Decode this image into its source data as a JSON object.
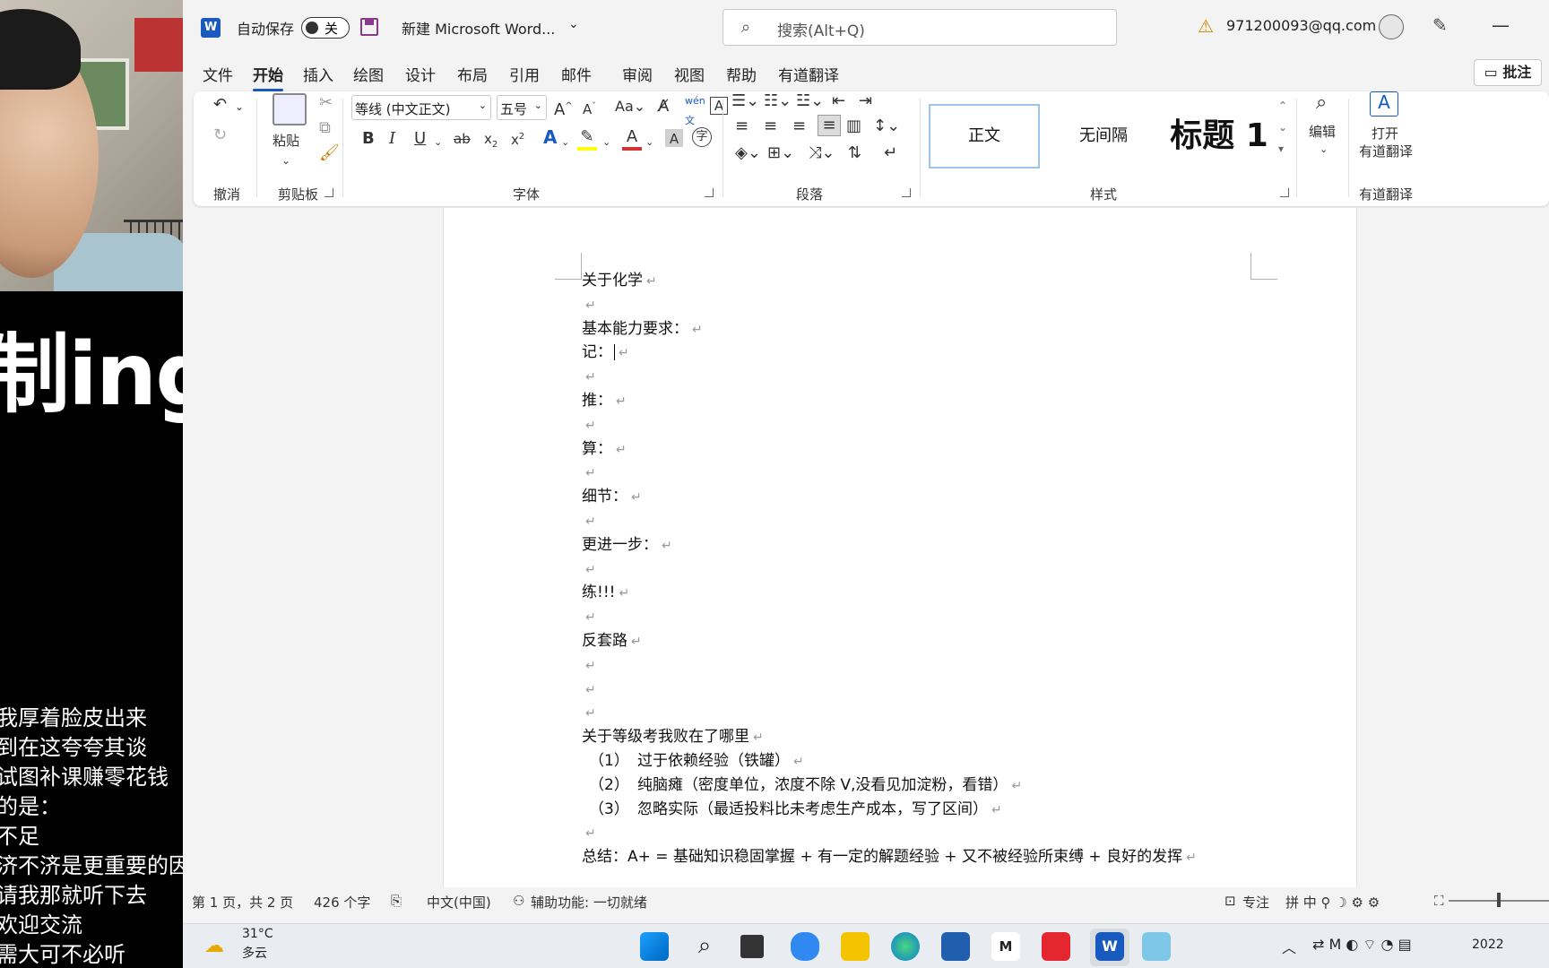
{
  "overlay": {
    "big_text": "制ing",
    "subtitles": [
      "我厚着脸皮出来",
      "到在这夸夸其谈",
      "试图补课赚零花钱",
      "的是：",
      "不足",
      "济不济是更重要的因素",
      "请我那就听下去",
      "欢迎交流",
      "需大可不必听"
    ]
  },
  "titlebar": {
    "autosave_label": "自动保存",
    "autosave_state": "关",
    "doc_title": "新建 Microsoft Word...",
    "search_placeholder": "搜索(Alt+Q)",
    "account": "971200093@qq.com"
  },
  "menu": {
    "items": [
      "文件",
      "开始",
      "插入",
      "绘图",
      "设计",
      "布局",
      "引用",
      "邮件",
      "审阅",
      "视图",
      "帮助",
      "有道翻译"
    ],
    "active": "开始",
    "comment_label": "批注"
  },
  "ribbon": {
    "groups": {
      "undo": "撤消",
      "clipboard": "剪贴板",
      "font": "字体",
      "paragraph": "段落",
      "styles": "样式",
      "editing": "编辑",
      "youdao": "有道翻译"
    },
    "paste_label": "粘贴",
    "font_name": "等线 (中文正文)",
    "font_size": "五号",
    "styles": [
      "正文",
      "无间隔",
      "标题 1"
    ],
    "edit_label": "编辑",
    "youdao_open": "打开",
    "youdao_label": "有道翻译"
  },
  "document": {
    "lines": [
      {
        "text": "关于化学"
      },
      {
        "text": ""
      },
      {
        "text": "基本能力要求："
      },
      {
        "text": "记："
      },
      {
        "text": ""
      },
      {
        "text": "推："
      },
      {
        "text": ""
      },
      {
        "text": "算："
      },
      {
        "text": ""
      },
      {
        "text": "细节："
      },
      {
        "text": ""
      },
      {
        "text": "更进一步："
      },
      {
        "text": ""
      },
      {
        "text": "练!!!"
      },
      {
        "text": ""
      },
      {
        "text": "反套路"
      },
      {
        "text": ""
      },
      {
        "text": ""
      },
      {
        "text": ""
      },
      {
        "text": "关于等级考我败在了哪里"
      },
      {
        "num": "（1）",
        "text": "过于依赖经验（铁罐）"
      },
      {
        "num": "（2）",
        "text": "纯脑瘫（密度单位，浓度不除 V,没看见加淀粉，看错）"
      },
      {
        "num": "（3）",
        "text": "忽略实际（最适投料比未考虑生产成本，写了区间）"
      },
      {
        "text": ""
      },
      {
        "text": "总结：A+ = 基础知识稳固掌握 + 有一定的解题经验 + 又不被经验所束缚 + 良好的发挥"
      }
    ]
  },
  "status": {
    "page": "第 1 页，共 2 页",
    "words": "426 个字",
    "language": "中文(中国)",
    "accessibility": "辅助功能: 一切就绪",
    "focus": "专注"
  },
  "taskbar": {
    "temperature": "31°C",
    "weather": "多云",
    "clock": "2022"
  },
  "colors": {
    "word_blue": "#185abd",
    "font_color_red": "#d13438",
    "highlight_yellow": "#ffff00"
  }
}
